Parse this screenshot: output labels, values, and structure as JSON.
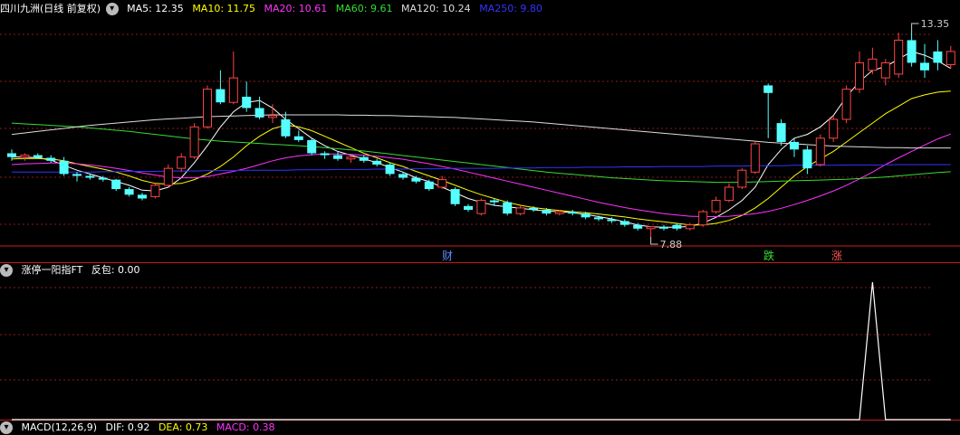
{
  "main_header": {
    "stock_title": "四川九洲(日线 前复权)",
    "ma": [
      {
        "label": "MA5: 12.35",
        "color": "#ffffff"
      },
      {
        "label": "MA10: 11.75",
        "color": "#ffff00"
      },
      {
        "label": "MA20: 10.61",
        "color": "#ff33ff"
      },
      {
        "label": "MA60: 9.61",
        "color": "#33dd33"
      },
      {
        "label": "MA120: 10.24",
        "color": "#dddddd"
      },
      {
        "label": "MA250: 9.80",
        "color": "#3333ff"
      }
    ]
  },
  "annotations": {
    "high_label": "13.35",
    "low_label": "7.88",
    "markers": [
      {
        "text": "财",
        "color": "#5a8cff"
      },
      {
        "text": "跌",
        "color": "#33dd33"
      },
      {
        "text": "涨",
        "color": "#ff5555"
      }
    ]
  },
  "indicator_header": {
    "title": "涨停一阳指FT",
    "value_label": "反包: 0.00"
  },
  "macd_header": {
    "title": "MACD(12,26,9)",
    "dif": "DIF: 0.92",
    "dea": "DEA: 0.73",
    "macd": "MACD: 0.38"
  },
  "colors": {
    "up": "#ff4444",
    "down": "#55ffff",
    "separator": "#c81e1e",
    "grid": "#8b1a1a"
  },
  "chart_data": {
    "type": "candlestick",
    "price_range": [
      7.88,
      13.35
    ],
    "candles": [
      {
        "o": 10.1,
        "h": 10.2,
        "l": 9.9,
        "c": 10.0
      },
      {
        "o": 10.0,
        "h": 10.1,
        "l": 9.9,
        "c": 10.05
      },
      {
        "o": 10.05,
        "h": 10.1,
        "l": 9.95,
        "c": 9.98
      },
      {
        "o": 9.98,
        "h": 10.05,
        "l": 9.85,
        "c": 9.9
      },
      {
        "o": 9.9,
        "h": 10.0,
        "l": 9.5,
        "c": 9.55
      },
      {
        "o": 9.55,
        "h": 9.6,
        "l": 9.35,
        "c": 9.5
      },
      {
        "o": 9.5,
        "h": 9.55,
        "l": 9.4,
        "c": 9.45
      },
      {
        "o": 9.45,
        "h": 9.5,
        "l": 9.35,
        "c": 9.4
      },
      {
        "o": 9.4,
        "h": 9.42,
        "l": 9.1,
        "c": 9.15
      },
      {
        "o": 9.15,
        "h": 9.2,
        "l": 8.95,
        "c": 9.0
      },
      {
        "o": 9.0,
        "h": 9.05,
        "l": 8.85,
        "c": 8.9
      },
      {
        "o": 8.95,
        "h": 9.3,
        "l": 8.9,
        "c": 9.25
      },
      {
        "o": 9.25,
        "h": 9.8,
        "l": 9.2,
        "c": 9.7
      },
      {
        "o": 9.7,
        "h": 10.1,
        "l": 9.6,
        "c": 10.0
      },
      {
        "o": 10.0,
        "h": 10.9,
        "l": 9.95,
        "c": 10.8
      },
      {
        "o": 10.8,
        "h": 11.9,
        "l": 10.75,
        "c": 11.8
      },
      {
        "o": 11.8,
        "h": 12.3,
        "l": 11.4,
        "c": 11.45
      },
      {
        "o": 11.45,
        "h": 12.8,
        "l": 11.4,
        "c": 12.1
      },
      {
        "o": 11.6,
        "h": 12.0,
        "l": 11.2,
        "c": 11.3
      },
      {
        "o": 11.3,
        "h": 11.6,
        "l": 11.0,
        "c": 11.05
      },
      {
        "o": 11.05,
        "h": 11.4,
        "l": 10.9,
        "c": 11.1
      },
      {
        "o": 11.0,
        "h": 11.2,
        "l": 10.5,
        "c": 10.55
      },
      {
        "o": 10.55,
        "h": 10.7,
        "l": 10.4,
        "c": 10.45
      },
      {
        "o": 10.45,
        "h": 10.5,
        "l": 10.05,
        "c": 10.1
      },
      {
        "o": 10.1,
        "h": 10.15,
        "l": 9.95,
        "c": 10.05
      },
      {
        "o": 10.05,
        "h": 10.15,
        "l": 9.9,
        "c": 9.95
      },
      {
        "o": 9.95,
        "h": 10.05,
        "l": 9.85,
        "c": 10.0
      },
      {
        "o": 10.0,
        "h": 10.05,
        "l": 9.85,
        "c": 9.9
      },
      {
        "o": 9.9,
        "h": 9.95,
        "l": 9.75,
        "c": 9.8
      },
      {
        "o": 9.8,
        "h": 9.85,
        "l": 9.5,
        "c": 9.55
      },
      {
        "o": 9.55,
        "h": 9.6,
        "l": 9.4,
        "c": 9.45
      },
      {
        "o": 9.45,
        "h": 9.5,
        "l": 9.3,
        "c": 9.35
      },
      {
        "o": 9.35,
        "h": 9.4,
        "l": 9.1,
        "c": 9.15
      },
      {
        "o": 9.2,
        "h": 9.5,
        "l": 9.15,
        "c": 9.4
      },
      {
        "o": 9.15,
        "h": 9.2,
        "l": 8.7,
        "c": 8.75
      },
      {
        "o": 8.7,
        "h": 8.75,
        "l": 8.55,
        "c": 8.6
      },
      {
        "o": 8.5,
        "h": 8.9,
        "l": 8.45,
        "c": 8.85
      },
      {
        "o": 8.85,
        "h": 8.9,
        "l": 8.7,
        "c": 8.8
      },
      {
        "o": 8.8,
        "h": 8.85,
        "l": 8.45,
        "c": 8.5
      },
      {
        "o": 8.5,
        "h": 8.7,
        "l": 8.45,
        "c": 8.65
      },
      {
        "o": 8.65,
        "h": 8.7,
        "l": 8.55,
        "c": 8.6
      },
      {
        "o": 8.6,
        "h": 8.65,
        "l": 8.45,
        "c": 8.5
      },
      {
        "o": 8.5,
        "h": 8.6,
        "l": 8.45,
        "c": 8.55
      },
      {
        "o": 8.55,
        "h": 8.6,
        "l": 8.45,
        "c": 8.5
      },
      {
        "o": 8.5,
        "h": 8.55,
        "l": 8.35,
        "c": 8.4
      },
      {
        "o": 8.4,
        "h": 8.45,
        "l": 8.3,
        "c": 8.35
      },
      {
        "o": 8.35,
        "h": 8.4,
        "l": 8.25,
        "c": 8.3
      },
      {
        "o": 8.3,
        "h": 8.35,
        "l": 8.15,
        "c": 8.2
      },
      {
        "o": 8.2,
        "h": 8.25,
        "l": 8.05,
        "c": 8.1
      },
      {
        "o": 8.1,
        "h": 8.15,
        "l": 7.88,
        "c": 8.15
      },
      {
        "o": 8.15,
        "h": 8.2,
        "l": 8.05,
        "c": 8.1
      },
      {
        "o": 8.2,
        "h": 8.25,
        "l": 8.05,
        "c": 8.1
      },
      {
        "o": 8.1,
        "h": 8.25,
        "l": 8.05,
        "c": 8.2
      },
      {
        "o": 8.2,
        "h": 8.6,
        "l": 8.15,
        "c": 8.55
      },
      {
        "o": 8.55,
        "h": 8.95,
        "l": 8.5,
        "c": 8.85
      },
      {
        "o": 8.85,
        "h": 9.3,
        "l": 8.8,
        "c": 9.2
      },
      {
        "o": 9.2,
        "h": 9.7,
        "l": 9.15,
        "c": 9.65
      },
      {
        "o": 9.6,
        "h": 10.4,
        "l": 9.55,
        "c": 10.35
      },
      {
        "o": 11.9,
        "h": 11.95,
        "l": 10.5,
        "c": 11.7
      },
      {
        "o": 10.9,
        "h": 11.0,
        "l": 10.3,
        "c": 10.4
      },
      {
        "o": 10.4,
        "h": 10.5,
        "l": 10.0,
        "c": 10.2
      },
      {
        "o": 10.2,
        "h": 10.3,
        "l": 9.55,
        "c": 9.7
      },
      {
        "o": 9.8,
        "h": 10.6,
        "l": 9.75,
        "c": 10.5
      },
      {
        "o": 10.5,
        "h": 11.1,
        "l": 10.4,
        "c": 11.0
      },
      {
        "o": 11.0,
        "h": 11.9,
        "l": 10.9,
        "c": 11.8
      },
      {
        "o": 11.8,
        "h": 12.8,
        "l": 11.7,
        "c": 12.5
      },
      {
        "o": 12.3,
        "h": 12.9,
        "l": 12.2,
        "c": 12.6
      },
      {
        "o": 12.1,
        "h": 12.6,
        "l": 11.9,
        "c": 12.5
      },
      {
        "o": 12.2,
        "h": 13.3,
        "l": 12.1,
        "c": 13.1
      },
      {
        "o": 13.1,
        "h": 13.35,
        "l": 12.4,
        "c": 12.5
      },
      {
        "o": 12.5,
        "h": 13.0,
        "l": 12.1,
        "c": 12.3
      },
      {
        "o": 12.8,
        "h": 13.1,
        "l": 12.3,
        "c": 12.5
      },
      {
        "o": 12.45,
        "h": 12.95,
        "l": 12.35,
        "c": 12.8
      }
    ],
    "ma_lines": {
      "MA5": [
        10.0,
        10.0,
        9.98,
        9.92,
        9.78,
        9.65,
        9.55,
        9.45,
        9.35,
        9.25,
        9.12,
        9.1,
        9.2,
        9.45,
        9.85,
        10.3,
        10.8,
        11.2,
        11.45,
        11.5,
        11.3,
        11.0,
        10.75,
        10.5,
        10.3,
        10.15,
        10.05,
        9.95,
        9.85,
        9.72,
        9.6,
        9.45,
        9.35,
        9.2,
        9.05,
        8.9,
        8.8,
        8.72,
        8.68,
        8.64,
        8.6,
        8.57,
        8.55,
        8.52,
        8.48,
        8.42,
        8.36,
        8.28,
        8.2,
        8.15,
        8.14,
        8.14,
        8.16,
        8.25,
        8.4,
        8.6,
        8.85,
        9.2,
        9.8,
        10.2,
        10.5,
        10.6,
        10.8,
        11.1,
        11.6,
        12.0,
        12.3,
        12.4,
        12.6,
        12.8,
        12.7,
        12.55,
        12.35
      ],
      "MA10": [
        9.95,
        9.96,
        9.96,
        9.95,
        9.9,
        9.82,
        9.75,
        9.68,
        9.6,
        9.5,
        9.38,
        9.3,
        9.28,
        9.3,
        9.4,
        9.55,
        9.75,
        10.0,
        10.3,
        10.55,
        10.75,
        10.85,
        10.8,
        10.7,
        10.55,
        10.4,
        10.25,
        10.1,
        9.98,
        9.85,
        9.75,
        9.62,
        9.5,
        9.38,
        9.25,
        9.12,
        9.0,
        8.9,
        8.8,
        8.72,
        8.66,
        8.62,
        8.58,
        8.55,
        8.52,
        8.49,
        8.45,
        8.41,
        8.36,
        8.32,
        8.28,
        8.24,
        8.2,
        8.2,
        8.24,
        8.32,
        8.45,
        8.65,
        8.9,
        9.2,
        9.5,
        9.75,
        9.95,
        10.15,
        10.4,
        10.65,
        10.9,
        11.15,
        11.35,
        11.55,
        11.65,
        11.72,
        11.75
      ],
      "MA20": [
        9.8,
        9.82,
        9.83,
        9.84,
        9.84,
        9.82,
        9.79,
        9.75,
        9.7,
        9.64,
        9.58,
        9.52,
        9.47,
        9.45,
        9.45,
        9.48,
        9.55,
        9.62,
        9.7,
        9.8,
        9.9,
        9.98,
        10.03,
        10.06,
        10.08,
        10.08,
        10.07,
        10.05,
        10.02,
        9.98,
        9.94,
        9.88,
        9.82,
        9.75,
        9.68,
        9.6,
        9.52,
        9.44,
        9.36,
        9.28,
        9.2,
        9.12,
        9.04,
        8.96,
        8.88,
        8.8,
        8.73,
        8.66,
        8.6,
        8.55,
        8.5,
        8.46,
        8.43,
        8.42,
        8.42,
        8.43,
        8.46,
        8.5,
        8.56,
        8.64,
        8.74,
        8.85,
        8.97,
        9.1,
        9.25,
        9.42,
        9.6,
        9.8,
        9.98,
        10.15,
        10.32,
        10.48,
        10.61
      ],
      "MA60": [
        10.9,
        10.88,
        10.86,
        10.84,
        10.82,
        10.8,
        10.77,
        10.74,
        10.71,
        10.68,
        10.64,
        10.6,
        10.56,
        10.52,
        10.48,
        10.45,
        10.42,
        10.4,
        10.38,
        10.36,
        10.34,
        10.32,
        10.3,
        10.28,
        10.25,
        10.22,
        10.19,
        10.16,
        10.12,
        10.08,
        10.04,
        10.0,
        9.96,
        9.92,
        9.88,
        9.84,
        9.8,
        9.76,
        9.72,
        9.68,
        9.64,
        9.6,
        9.57,
        9.54,
        9.51,
        9.48,
        9.45,
        9.43,
        9.41,
        9.39,
        9.37,
        9.36,
        9.35,
        9.34,
        9.33,
        9.33,
        9.33,
        9.34,
        9.35,
        9.36,
        9.37,
        9.38,
        9.39,
        9.4,
        9.41,
        9.43,
        9.45,
        9.47,
        9.5,
        9.53,
        9.56,
        9.59,
        9.61
      ],
      "MA120": [
        10.6,
        10.64,
        10.68,
        10.72,
        10.76,
        10.8,
        10.84,
        10.87,
        10.9,
        10.93,
        10.96,
        10.99,
        11.01,
        11.03,
        11.05,
        11.07,
        11.08,
        11.09,
        11.1,
        11.11,
        11.12,
        11.12,
        11.12,
        11.12,
        11.12,
        11.12,
        11.11,
        11.11,
        11.1,
        11.1,
        11.09,
        11.08,
        11.07,
        11.06,
        11.05,
        11.03,
        11.01,
        10.99,
        10.97,
        10.95,
        10.93,
        10.9,
        10.87,
        10.84,
        10.81,
        10.78,
        10.75,
        10.72,
        10.69,
        10.66,
        10.63,
        10.6,
        10.57,
        10.54,
        10.51,
        10.48,
        10.45,
        10.42,
        10.39,
        10.37,
        10.35,
        10.33,
        10.31,
        10.29,
        10.28,
        10.27,
        10.26,
        10.25,
        10.25,
        10.24,
        10.24,
        10.24,
        10.24
      ],
      "MA250": [
        9.6,
        9.6,
        9.6,
        9.6,
        9.6,
        9.6,
        9.6,
        9.61,
        9.61,
        9.62,
        9.62,
        9.62,
        9.63,
        9.63,
        9.63,
        9.64,
        9.64,
        9.64,
        9.65,
        9.65,
        9.65,
        9.65,
        9.66,
        9.66,
        9.66,
        9.67,
        9.67,
        9.67,
        9.68,
        9.68,
        9.68,
        9.69,
        9.69,
        9.69,
        9.7,
        9.7,
        9.7,
        9.7,
        9.71,
        9.71,
        9.71,
        9.72,
        9.72,
        9.72,
        9.73,
        9.73,
        9.73,
        9.74,
        9.74,
        9.74,
        9.75,
        9.75,
        9.75,
        9.75,
        9.76,
        9.76,
        9.76,
        9.77,
        9.77,
        9.77,
        9.78,
        9.78,
        9.78,
        9.78,
        9.79,
        9.79,
        9.79,
        9.79,
        9.8,
        9.8,
        9.8,
        9.8,
        9.8
      ]
    },
    "indicator_series": {
      "name": "反包",
      "values": [
        0,
        0,
        0,
        0,
        0,
        0,
        0,
        0,
        0,
        0,
        0,
        0,
        0,
        0,
        0,
        0,
        0,
        0,
        0,
        0,
        0,
        0,
        0,
        0,
        0,
        0,
        0,
        0,
        0,
        0,
        0,
        0,
        0,
        0,
        0,
        0,
        0,
        0,
        0,
        0,
        0,
        0,
        0,
        0,
        0,
        0,
        0,
        0,
        0,
        0,
        0,
        0,
        0,
        0,
        0,
        0,
        0,
        0,
        0,
        0,
        0,
        0,
        0,
        0,
        0,
        0,
        1,
        0,
        0,
        0,
        0,
        0,
        0
      ]
    }
  }
}
